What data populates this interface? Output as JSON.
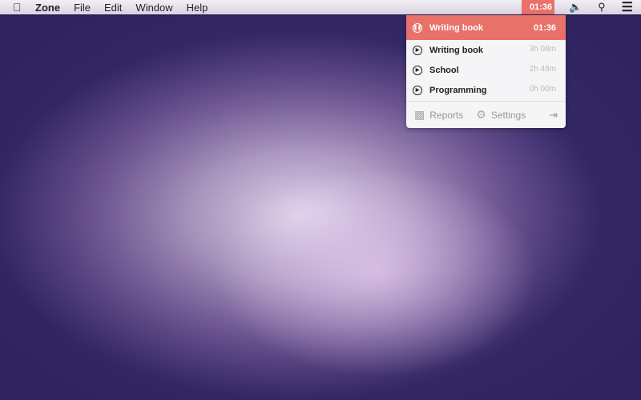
{
  "menubar": {
    "app": "Zone",
    "items": [
      "File",
      "Edit",
      "Window",
      "Help"
    ],
    "timer": "01:36"
  },
  "popover": {
    "active": {
      "name": "Writing book",
      "time": "01:36"
    },
    "items": [
      {
        "name": "Writing book",
        "time": "3h 08m"
      },
      {
        "name": "School",
        "time": "2h 48m"
      },
      {
        "name": "Programming",
        "time": "0h 00m"
      }
    ],
    "footer": {
      "reports": "Reports",
      "settings": "Settings"
    }
  },
  "colors": {
    "accent": "#e8716a"
  }
}
